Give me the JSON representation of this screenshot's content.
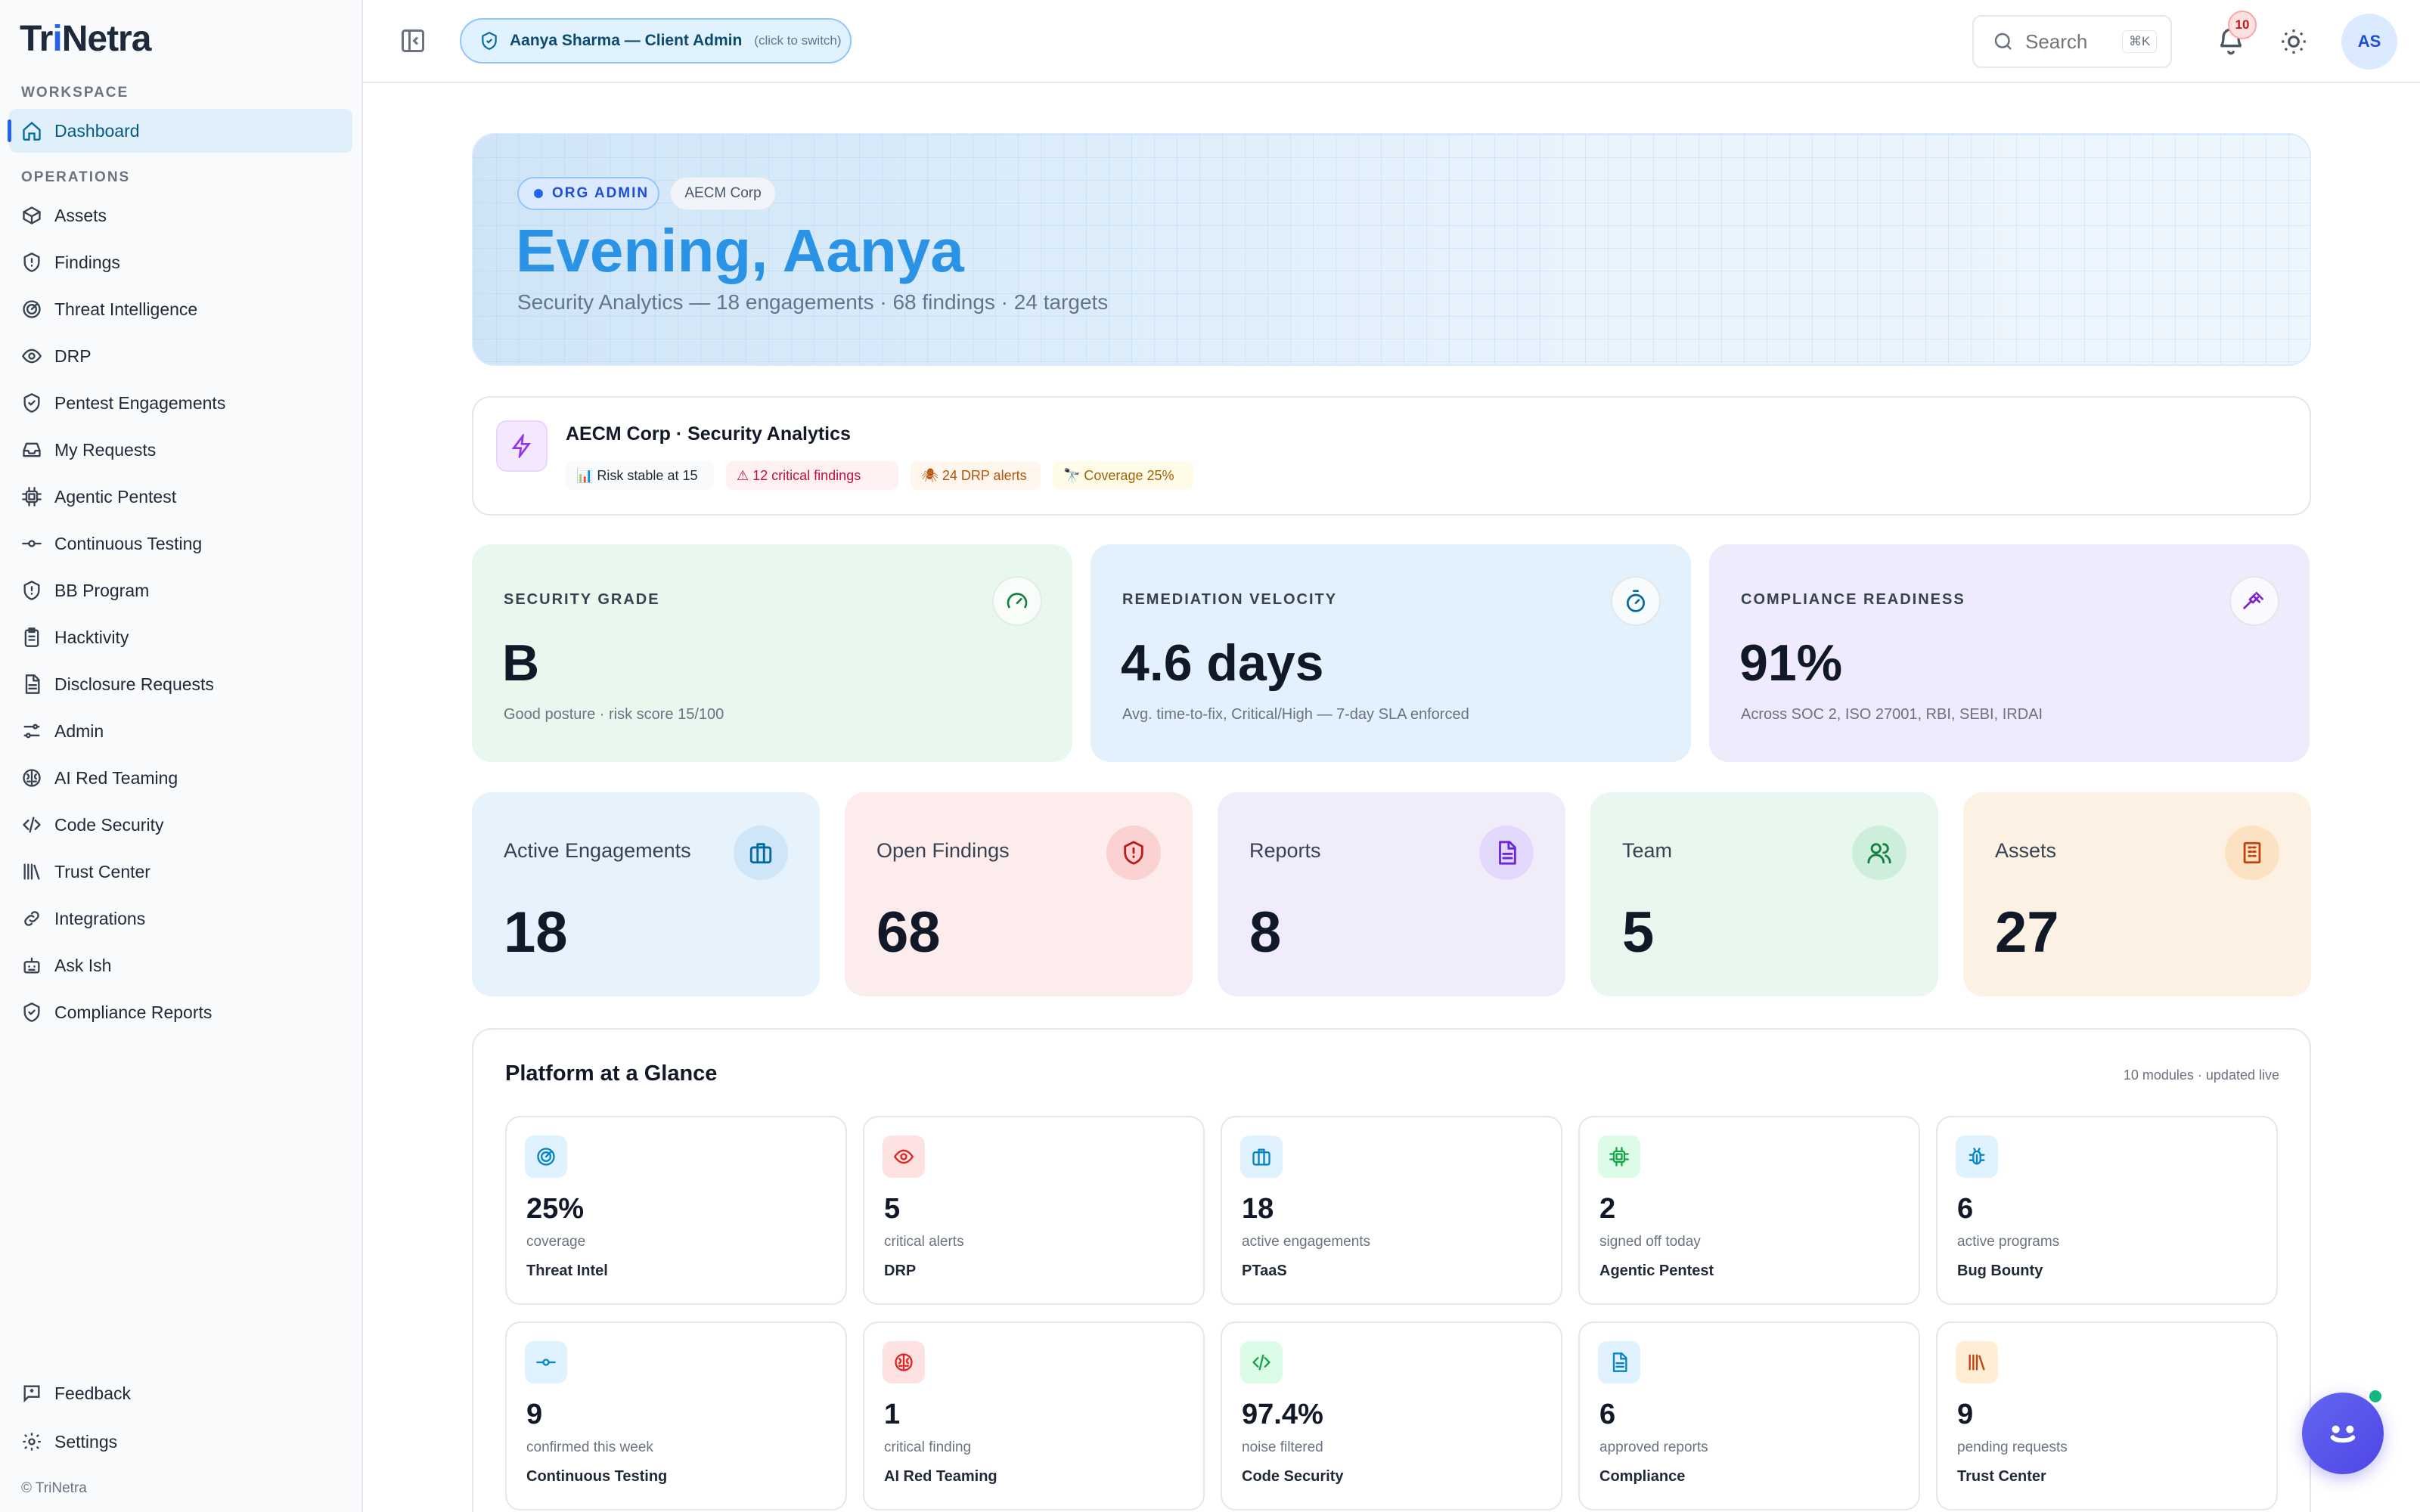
{
  "brand": {
    "logo_prefix": "Tr",
    "logo_mid": "i",
    "logo_suffix": "Netra"
  },
  "sidebar": {
    "section_workspace": "WORKSPACE",
    "section_operations": "OPERATIONS",
    "dashboard": "Dashboard",
    "items": [
      {
        "label": "Assets",
        "icon": "box-icon"
      },
      {
        "label": "Findings",
        "icon": "shield-alert-icon"
      },
      {
        "label": "Threat Intelligence",
        "icon": "radar-icon"
      },
      {
        "label": "DRP",
        "icon": "eye-icon"
      },
      {
        "label": "Pentest Engagements",
        "icon": "shield-check-icon"
      },
      {
        "label": "My Requests",
        "icon": "inbox-icon"
      },
      {
        "label": "Agentic Pentest",
        "icon": "cpu-icon"
      },
      {
        "label": "Continuous Testing",
        "icon": "commit-icon"
      },
      {
        "label": "BB Program",
        "icon": "shield-icon"
      },
      {
        "label": "Hacktivity",
        "icon": "clipboard-icon"
      },
      {
        "label": "Disclosure Requests",
        "icon": "document-icon"
      },
      {
        "label": "Admin",
        "icon": "sliders-icon"
      },
      {
        "label": "AI Red Teaming",
        "icon": "brain-icon"
      },
      {
        "label": "Code Security",
        "icon": "code-icon"
      },
      {
        "label": "Trust Center",
        "icon": "library-icon"
      },
      {
        "label": "Integrations",
        "icon": "link-icon"
      },
      {
        "label": "Ask Ish",
        "icon": "robot-icon"
      },
      {
        "label": "Compliance Reports",
        "icon": "shield-check-icon"
      }
    ],
    "feedback": "Feedback",
    "settings": "Settings",
    "copyright": "© TriNetra"
  },
  "topbar": {
    "role_name": "Aanya Sharma — Client Admin",
    "role_hint": "(click to switch)",
    "search_placeholder": "Search",
    "search_kbd": "⌘K",
    "notifications": "10",
    "avatar": "AS"
  },
  "hero": {
    "role_pill": "ORG ADMIN",
    "org_pill": "AECM Corp",
    "title": "Evening, Aanya",
    "subtitle": "Security Analytics — 18 engagements · 68 findings · 24 targets"
  },
  "org_card": {
    "title": "AECM Corp · Security Analytics",
    "chips": [
      {
        "label": "📊 Risk stable at 15",
        "color": "#1f2937",
        "bg": "#f8fafc"
      },
      {
        "label": "⚠ 12 critical findings",
        "color": "#be123c",
        "bg": "#fff1f2"
      },
      {
        "label": "🕷 24 DRP alerts",
        "color": "#b45309",
        "bg": "#fff7ed"
      },
      {
        "label": "🔭 Coverage 25%",
        "color": "#a16207",
        "bg": "#fefce8"
      }
    ]
  },
  "stats": [
    {
      "label": "SECURITY GRADE",
      "value": "B",
      "sub": "Good posture · risk score 15/100",
      "bg": "#e8f8ee",
      "icon": "gauge-icon"
    },
    {
      "label": "REMEDIATION VELOCITY",
      "value": "4.6 days",
      "sub": "Avg. time-to-fix, Critical/High — 7-day SLA enforced",
      "bg": "#e3f1fc",
      "icon": "timer-icon"
    },
    {
      "label": "COMPLIANCE READINESS",
      "value": "91%",
      "sub": "Across SOC 2, ISO 27001, RBI, SEBI, IRDAI",
      "bg": "#efeafc",
      "icon": "gavel-icon"
    }
  ],
  "metrics": [
    {
      "label": "Active Engagements",
      "value": "18",
      "bg": "#e6f2fc",
      "icon_bg": "#cfe6f9",
      "icon": "briefcase-icon"
    },
    {
      "label": "Open Findings",
      "value": "68",
      "bg": "#fdecec",
      "icon_bg": "#fbd1d1",
      "icon": "shield-alert-icon"
    },
    {
      "label": "Reports",
      "value": "8",
      "bg": "#f0ecfc",
      "icon_bg": "#e2d8fb",
      "icon": "document-icon"
    },
    {
      "label": "Team",
      "value": "5",
      "bg": "#e8f8ee",
      "icon_bg": "#cdeeda",
      "icon": "users-icon"
    },
    {
      "label": "Assets",
      "value": "27",
      "bg": "#fdf1e3",
      "icon_bg": "#fbe2c2",
      "icon": "building-icon"
    }
  ],
  "platform": {
    "title": "Platform at a Glance",
    "meta": "10 modules · updated live",
    "tiles": [
      {
        "value": "25%",
        "sub": "coverage",
        "name": "Threat Intel",
        "icon": "radar-icon",
        "bg": "#e0f2fe",
        "fg": "#0284c7"
      },
      {
        "value": "5",
        "sub": "critical alerts",
        "name": "DRP",
        "icon": "eye-icon",
        "bg": "#fee2e2",
        "fg": "#dc2626"
      },
      {
        "value": "18",
        "sub": "active engagements",
        "name": "PTaaS",
        "icon": "briefcase-icon",
        "bg": "#e0f2fe",
        "fg": "#0284c7"
      },
      {
        "value": "2",
        "sub": "signed off today",
        "name": "Agentic Pentest",
        "icon": "cpu-icon",
        "bg": "#dcfce7",
        "fg": "#16a34a"
      },
      {
        "value": "6",
        "sub": "active programs",
        "name": "Bug Bounty",
        "icon": "bug-icon",
        "bg": "#e0f2fe",
        "fg": "#0284c7"
      },
      {
        "value": "9",
        "sub": "confirmed this week",
        "name": "Continuous Testing",
        "icon": "commit-icon",
        "bg": "#e0f2fe",
        "fg": "#0284c7"
      },
      {
        "value": "1",
        "sub": "critical finding",
        "name": "AI Red Teaming",
        "icon": "brain-icon",
        "bg": "#fee2e2",
        "fg": "#dc2626"
      },
      {
        "value": "97.4%",
        "sub": "noise filtered",
        "name": "Code Security",
        "icon": "code-icon",
        "bg": "#dcfce7",
        "fg": "#16a34a"
      },
      {
        "value": "6",
        "sub": "approved reports",
        "name": "Compliance",
        "icon": "document-icon",
        "bg": "#e0f2fe",
        "fg": "#0284c7"
      },
      {
        "value": "9",
        "sub": "pending requests",
        "name": "Trust Center",
        "icon": "library-icon",
        "bg": "#ffedd5",
        "fg": "#c2410c"
      }
    ]
  }
}
